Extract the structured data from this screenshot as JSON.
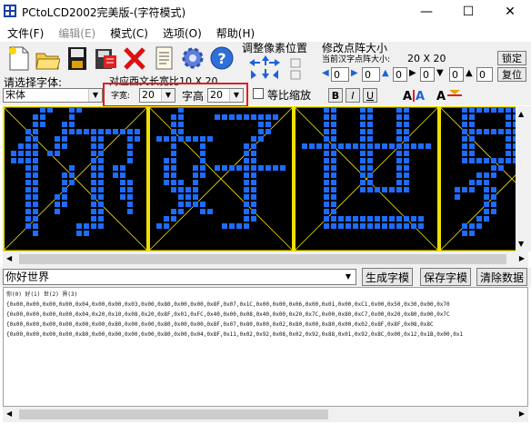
{
  "window": {
    "title": "PCtoLCD2002完美版-(字符模式)",
    "controls": {
      "minimize": "—",
      "maximize": "☐",
      "close": "✕"
    }
  },
  "menu": [
    {
      "label": "文件(F)",
      "disabled": false
    },
    {
      "label": "编辑(E)",
      "disabled": true
    },
    {
      "label": "模式(C)",
      "disabled": false
    },
    {
      "label": "选项(O)",
      "disabled": false
    },
    {
      "label": "帮助(H)",
      "disabled": false
    }
  ],
  "toolbar": {
    "pixel_adjust_label": "调整像素位置",
    "dot_size_label": "修改点阵大小",
    "dot_size_current_label": "当前汉字点阵大小:",
    "dot_size_value": "20 X 20",
    "lock_button": "锁定",
    "reset_button": "复位",
    "spin_values": [
      "0",
      "0",
      "0",
      "0",
      "0",
      "0"
    ]
  },
  "font": {
    "select_label": "请选择字体:",
    "font_name": "宋体",
    "width_label": "字宽:",
    "width_value": "20",
    "height_label": "字高",
    "height_value": "20",
    "proportional_label": "等比缩放",
    "proportional_checked": false,
    "bold_label": "B",
    "italic_label": "I",
    "underline_label": "U",
    "preview_caption": "对应西文长宽比10 X 20"
  },
  "canvas": {
    "background": "#000000",
    "dot_color": "#1e6cff",
    "grid_color": "#f0e000",
    "characters": [
      "你",
      "好",
      "世",
      "界"
    ]
  },
  "input": {
    "text": "你好世界",
    "generate_button": "生成字模",
    "save_button": "保存字模",
    "clear_button": "清除数据"
  },
  "output_lines": [
    "你(0) 好(1) 世(2) 界(3)",
    "{0x00,0x00,0x00,0x00,0x04,0x00,0x00,0x03,0x00,0x80,0x00,0x00,0x8F,0x07,0x1C,0x00,0x00,0x06,0x00,0x01,0x00,0xC1,0x00,0x50,0x30,0x00,0x70",
    "{0x00,0x00,0x00,0x00,0x04,0x20,0x10,0x08,0x20,0x8F,0x01,0xFC,0x40,0x00,0x08,0x40,0x00,0x20,0x7C,0x00,0x80,0xC7,0x00,0x20,0x80,0x00,0x7C",
    "{0x00,0x00,0x00,0x00,0x00,0x00,0x80,0x00,0x00,0x80,0x00,0x00,0x8F,0x07,0x80,0x00,0x02,0x80,0x00,0x80,0x00,0x02,0x8F,0x8F,0x08,0x8C",
    "{0x00,0x00,0x00,0x00,0x80,0x00,0x00,0x00,0x00,0x80,0x00,0x04,0x8F,0x11,0x02,0x92,0x08,0x02,0x92,0x88,0x01,0x92,0x8C,0x00,0x12,0x1B,0x00,0x1"
  ]
}
